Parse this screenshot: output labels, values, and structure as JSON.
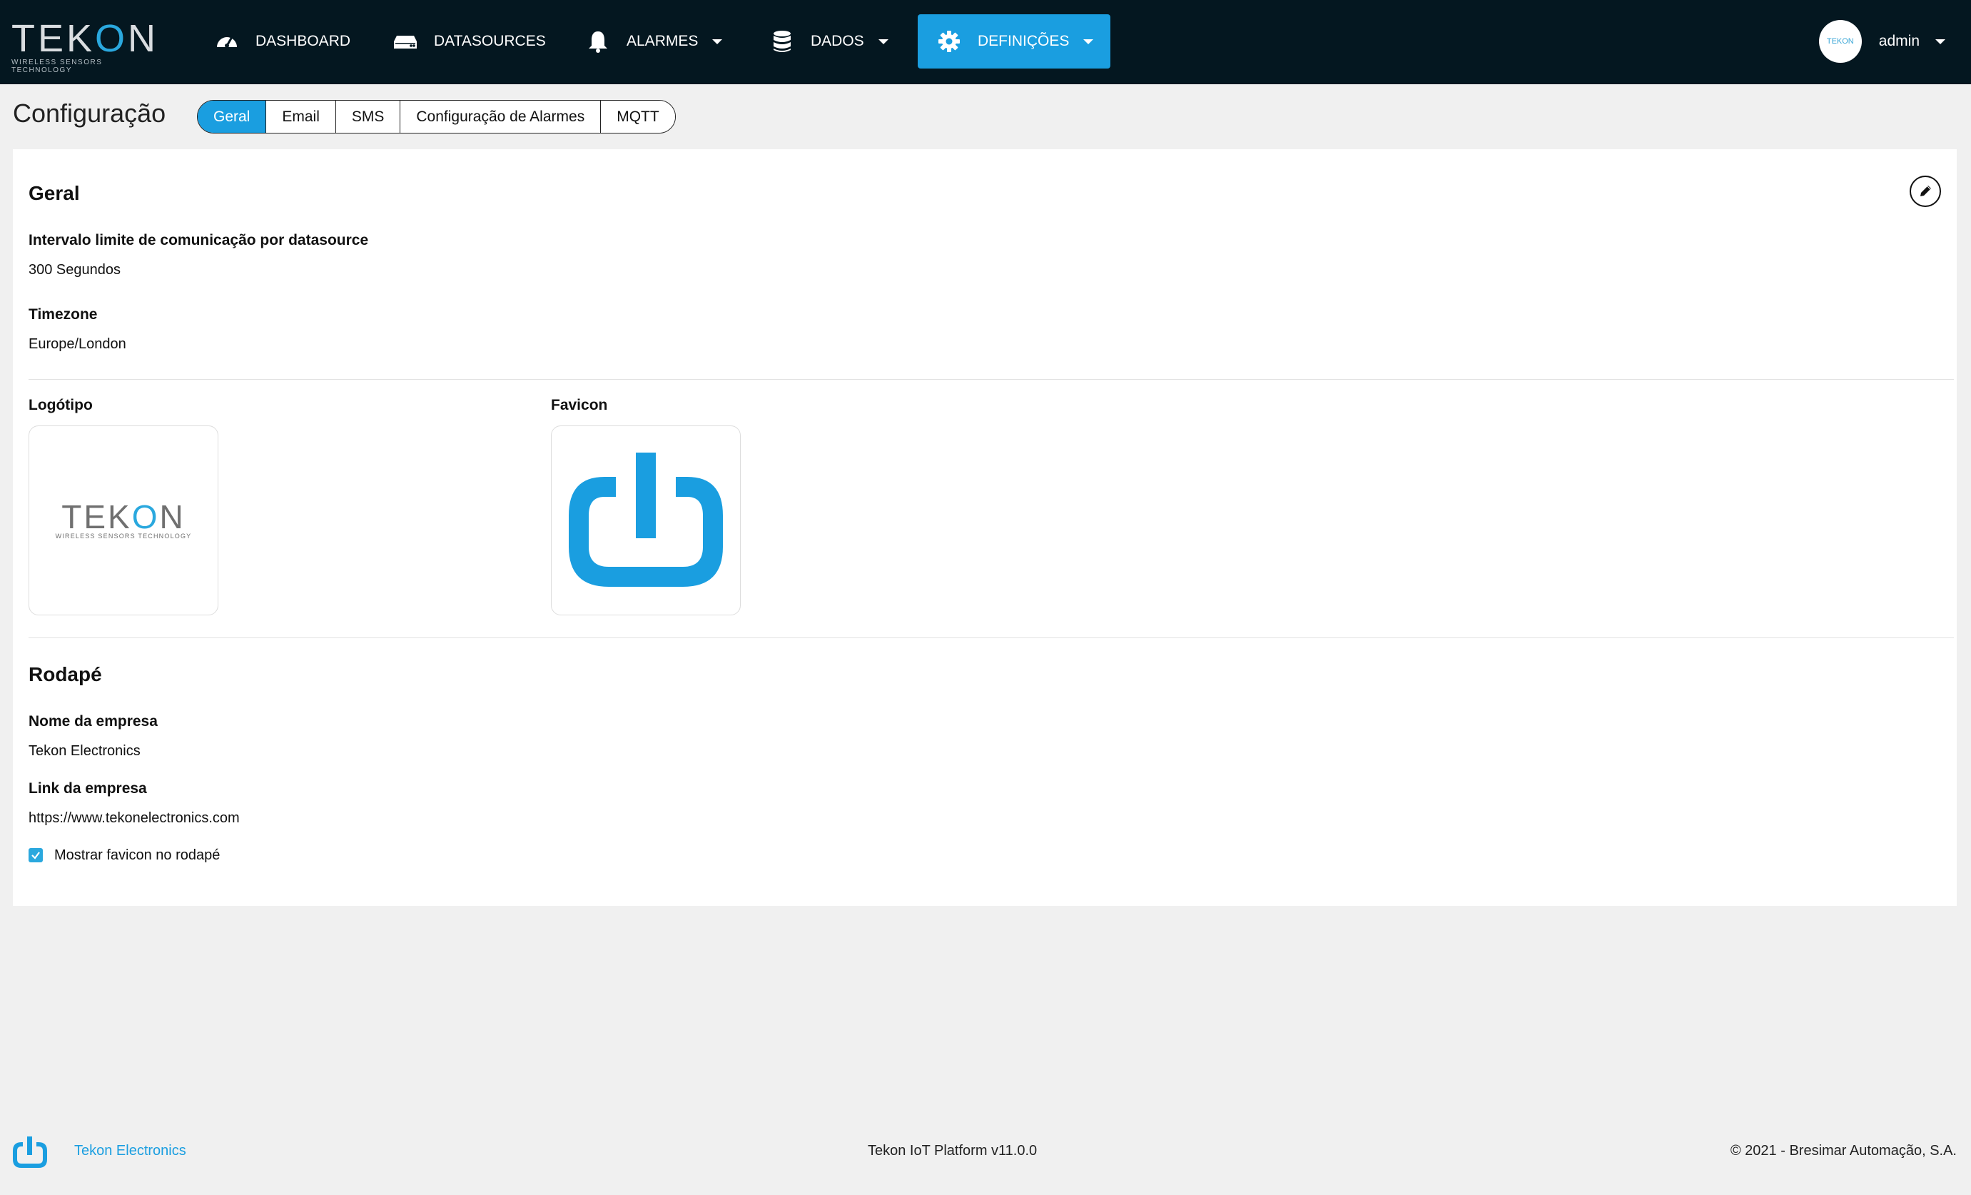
{
  "brand": {
    "logo_text_left": "TEK",
    "logo_text_o": "O",
    "logo_text_right": "N",
    "tagline": "WIRELESS SENSORS TECHNOLOGY"
  },
  "nav": {
    "dashboard": "DASHBOARD",
    "datasources": "DATASOURCES",
    "alarms": "ALARMES",
    "data": "DADOS",
    "settings": "DEFINIÇÕES"
  },
  "user": {
    "name": "admin",
    "avatar_text": "TEKON"
  },
  "page": {
    "title": "Configuração"
  },
  "tabs": [
    "Geral",
    "Email",
    "SMS",
    "Configuração de Alarmes",
    "MQTT"
  ],
  "general": {
    "heading": "Geral",
    "comm_interval_label": "Intervalo limite de comunicação por datasource",
    "comm_interval_value": "300 Segundos",
    "timezone_label": "Timezone",
    "timezone_value": "Europe/London",
    "logo_label": "Logótipo",
    "favicon_label": "Favicon"
  },
  "footer_section": {
    "heading": "Rodapé",
    "company_name_label": "Nome da empresa",
    "company_name_value": "Tekon Electronics",
    "company_link_label": "Link da empresa",
    "company_link_value": "https://www.tekonelectronics.com",
    "show_favicon_label": "Mostrar favicon no rodapé",
    "show_favicon_checked": true
  },
  "page_footer": {
    "company_link": "Tekon Electronics",
    "platform": "Tekon IoT Platform v11.0.0",
    "copyright": "© 2021 - Bresimar Automação, S.A."
  },
  "colors": {
    "accent": "#1a9ee0",
    "topbar": "#041720",
    "brand_blue": "#2aa8de"
  },
  "icons": [
    "speedometer-icon",
    "server-icon",
    "bell-icon",
    "database-icon",
    "gear-icon",
    "pencil-icon",
    "power-icon",
    "check-icon"
  ]
}
